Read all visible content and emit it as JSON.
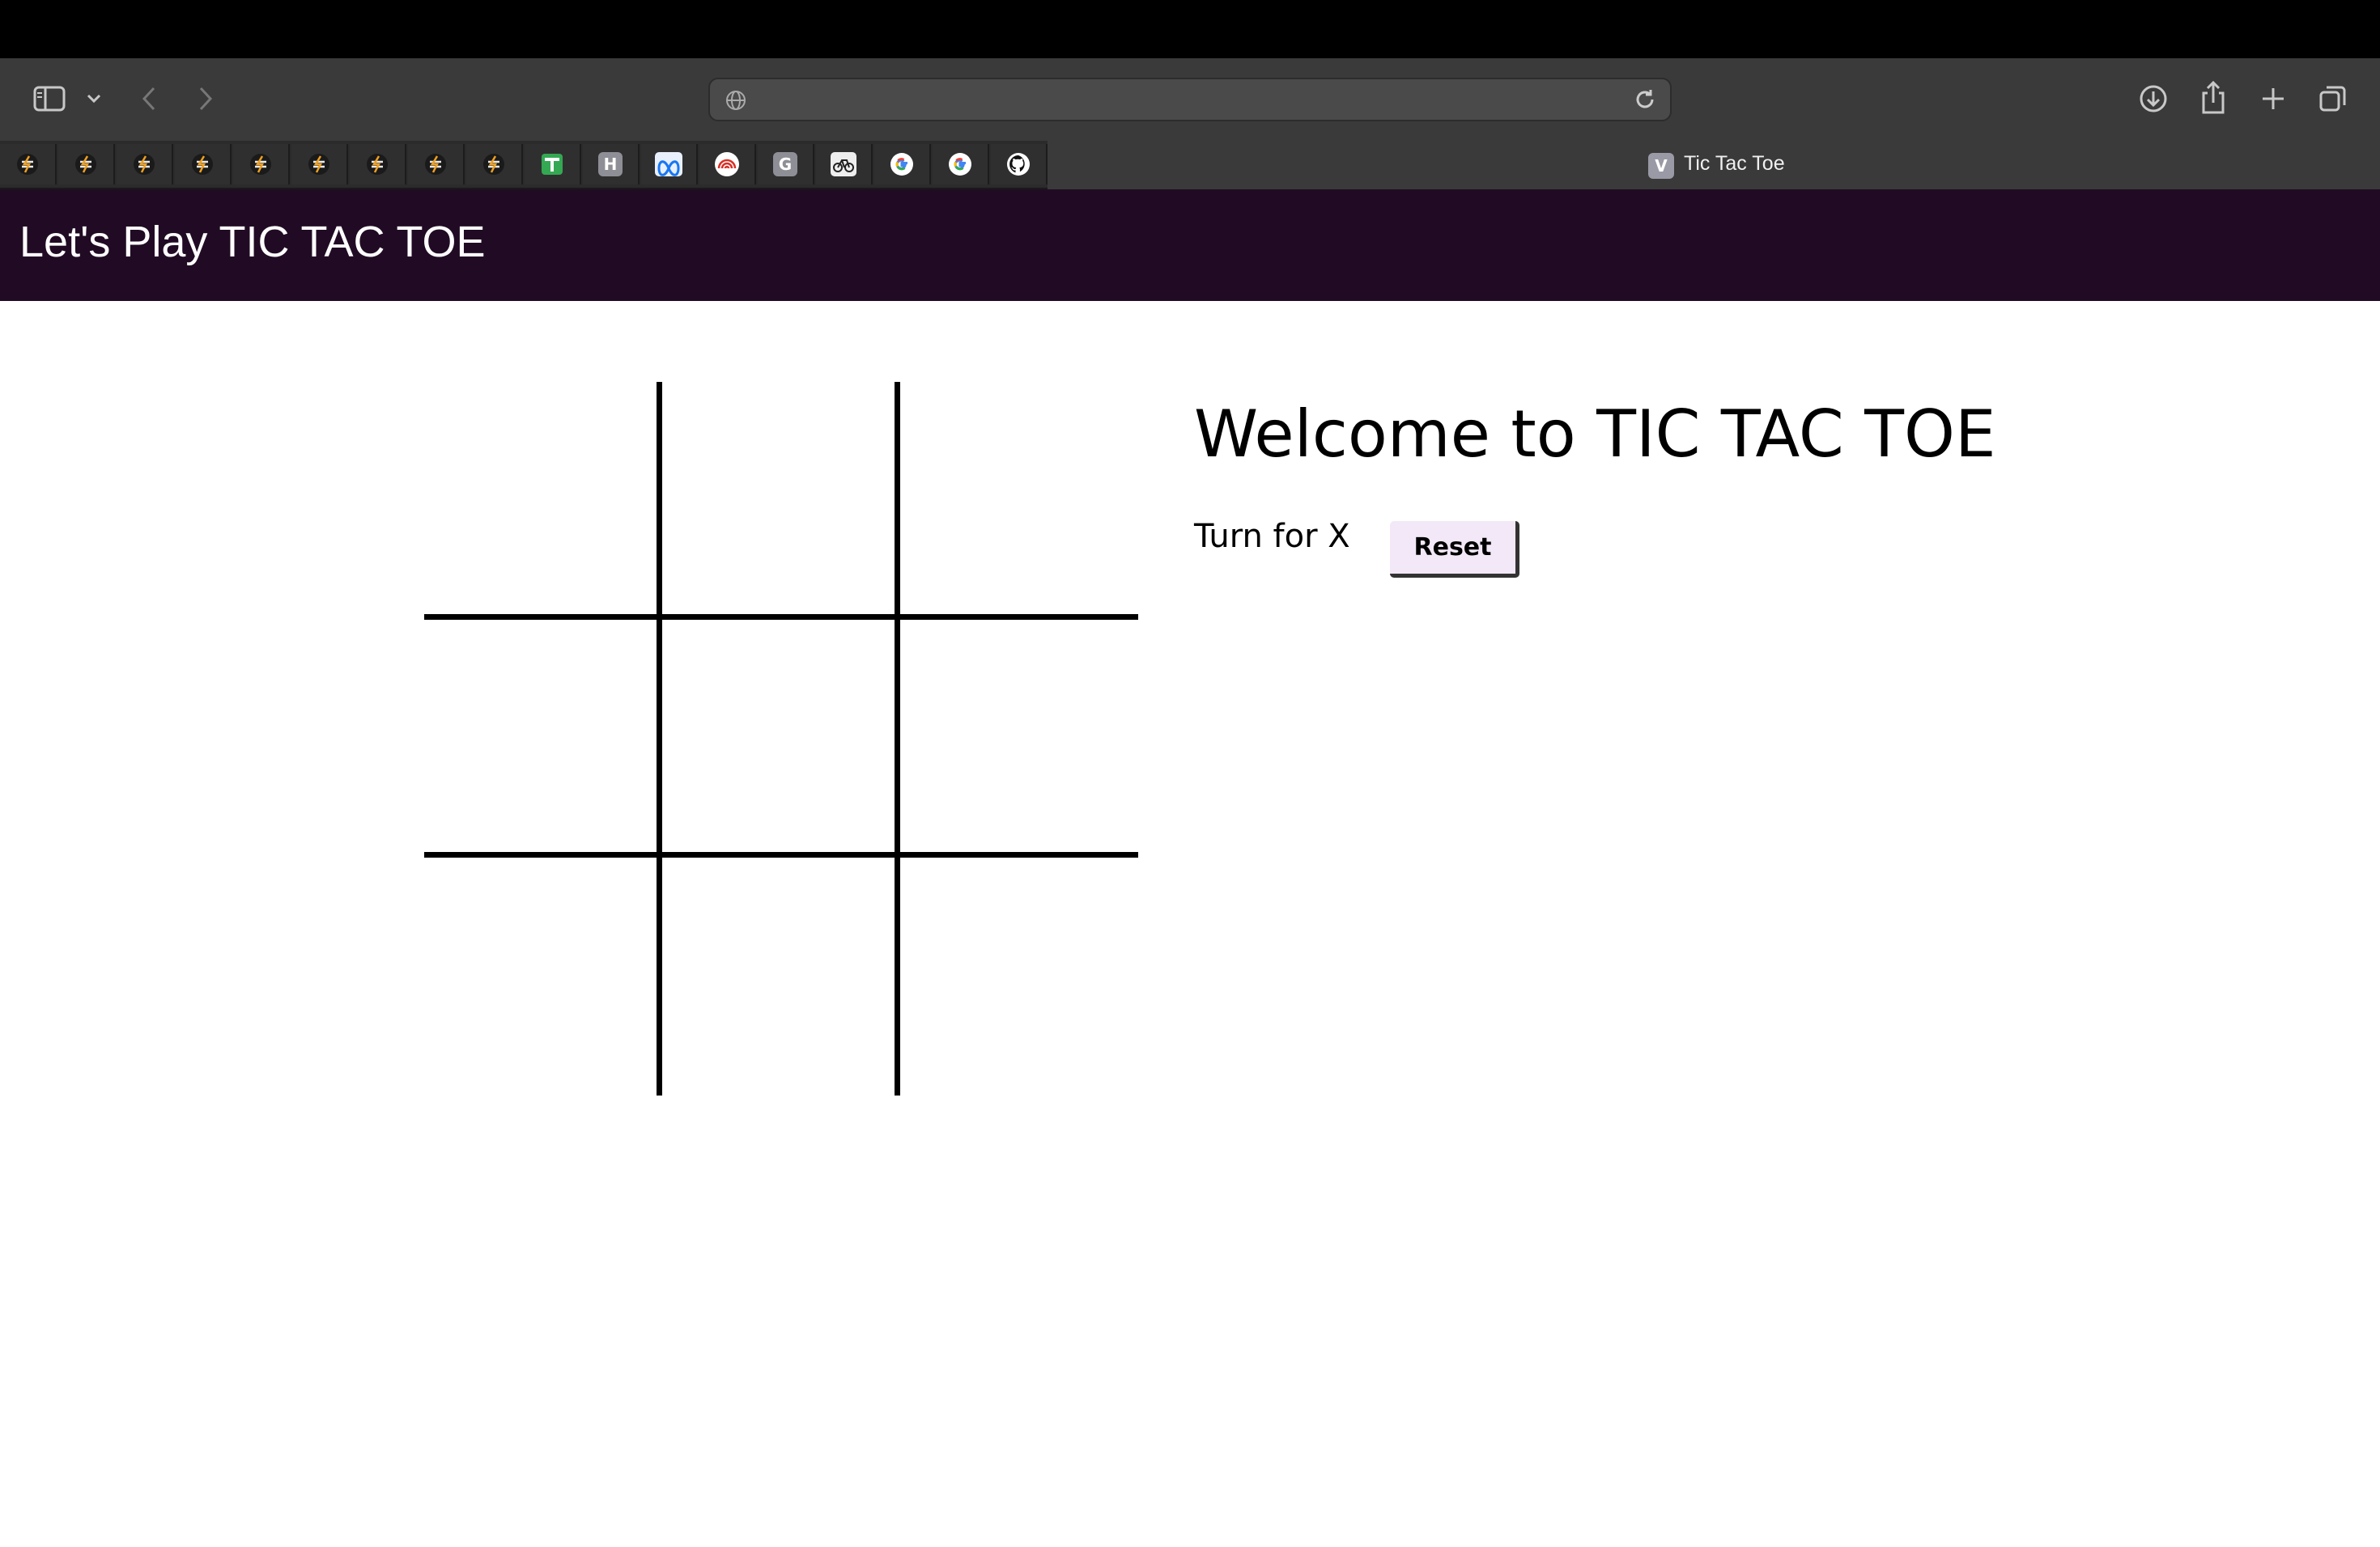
{
  "browser": {
    "address": {
      "value": "",
      "placeholder": ""
    },
    "pinned_tabs": [
      {
        "icon": "lightning-icon",
        "letter": ""
      },
      {
        "icon": "lightning-icon",
        "letter": ""
      },
      {
        "icon": "lightning-icon",
        "letter": ""
      },
      {
        "icon": "lightning-icon",
        "letter": ""
      },
      {
        "icon": "lightning-icon",
        "letter": ""
      },
      {
        "icon": "lightning-icon",
        "letter": ""
      },
      {
        "icon": "lightning-icon",
        "letter": ""
      },
      {
        "icon": "lightning-icon",
        "letter": ""
      },
      {
        "icon": "lightning-icon",
        "letter": ""
      },
      {
        "icon": "green-grid-icon",
        "letter": ""
      },
      {
        "icon": "letter-icon",
        "letter": "H"
      },
      {
        "icon": "meta-icon",
        "letter": ""
      },
      {
        "icon": "red-rings-icon",
        "letter": ""
      },
      {
        "icon": "letter-icon",
        "letter": "G"
      },
      {
        "icon": "bicycle-icon",
        "letter": ""
      },
      {
        "icon": "google-icon",
        "letter": ""
      },
      {
        "icon": "google-icon",
        "letter": ""
      },
      {
        "icon": "github-icon",
        "letter": ""
      }
    ],
    "active_tab": {
      "favicon_letter": "V",
      "title": "Tic Tac Toe"
    }
  },
  "app": {
    "header_title": "Let's Play TIC TAC TOE",
    "welcome": "Welcome to TIC TAC TOE",
    "turn_text": "Turn for X",
    "reset_label": "Reset",
    "board": [
      "",
      "",
      "",
      "",
      "",
      "",
      "",
      "",
      ""
    ]
  },
  "colors": {
    "header_bg": "#210b24",
    "reset_bg": "#f2e8f7",
    "toolbar_bg": "#3a3a3a"
  }
}
